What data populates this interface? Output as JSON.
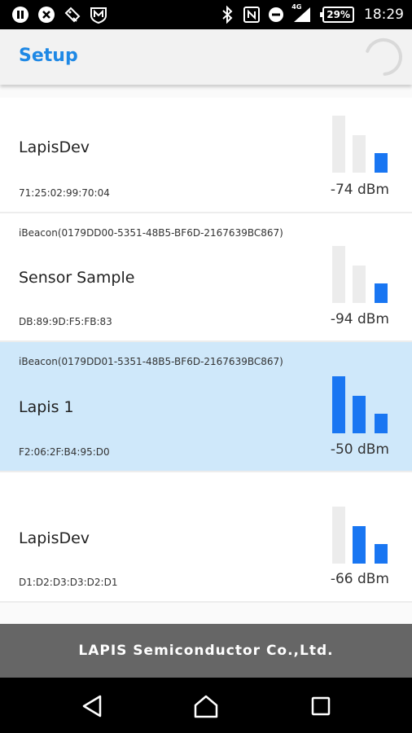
{
  "status_bar": {
    "left_icons": [
      "pause-circle-icon",
      "close-circle-icon",
      "pet-tag-icon",
      "shield-m-icon"
    ],
    "right_icons": [
      "bluetooth-icon",
      "nfc-icon",
      "do-not-disturb-icon",
      "signal-4g-icon"
    ],
    "network_label": "4G",
    "battery": "29%",
    "time": "18:29"
  },
  "app_bar": {
    "title": "Setup",
    "spinner_icon": "loading-spinner-icon"
  },
  "devices": [
    {
      "uuid": "",
      "name": "LapisDev",
      "address": "71:25:02:99:70:04",
      "rssi": "-74 dBm",
      "bars_active": 1,
      "selected": false
    },
    {
      "uuid": "iBeacon(0179DD00-5351-48B5-BF6D-2167639BC867)",
      "name": "Sensor Sample",
      "address": "DB:89:9D:F5:FB:83",
      "rssi": "-94 dBm",
      "bars_active": 1,
      "selected": false
    },
    {
      "uuid": "iBeacon(0179DD01-5351-48B5-BF6D-2167639BC867)",
      "name": "Lapis 1",
      "address": "F2:06:2F:B4:95:D0",
      "rssi": "-50 dBm",
      "bars_active": 3,
      "selected": true
    },
    {
      "uuid": "",
      "name": "LapisDev",
      "address": "D1:D2:D3:D3:D2:D1",
      "rssi": "-66 dBm",
      "bars_active": 2,
      "selected": false
    }
  ],
  "footer": {
    "text": "LAPIS Semiconductor Co.,Ltd."
  },
  "nav_bar": {
    "buttons": [
      "back-icon",
      "home-icon",
      "recents-icon"
    ]
  },
  "colors": {
    "accent": "#1e88e5",
    "bar_active": "#1976f2",
    "bar_inactive": "#ececec",
    "selected_row": "#cfe8fa",
    "footer_bg": "#666666"
  }
}
